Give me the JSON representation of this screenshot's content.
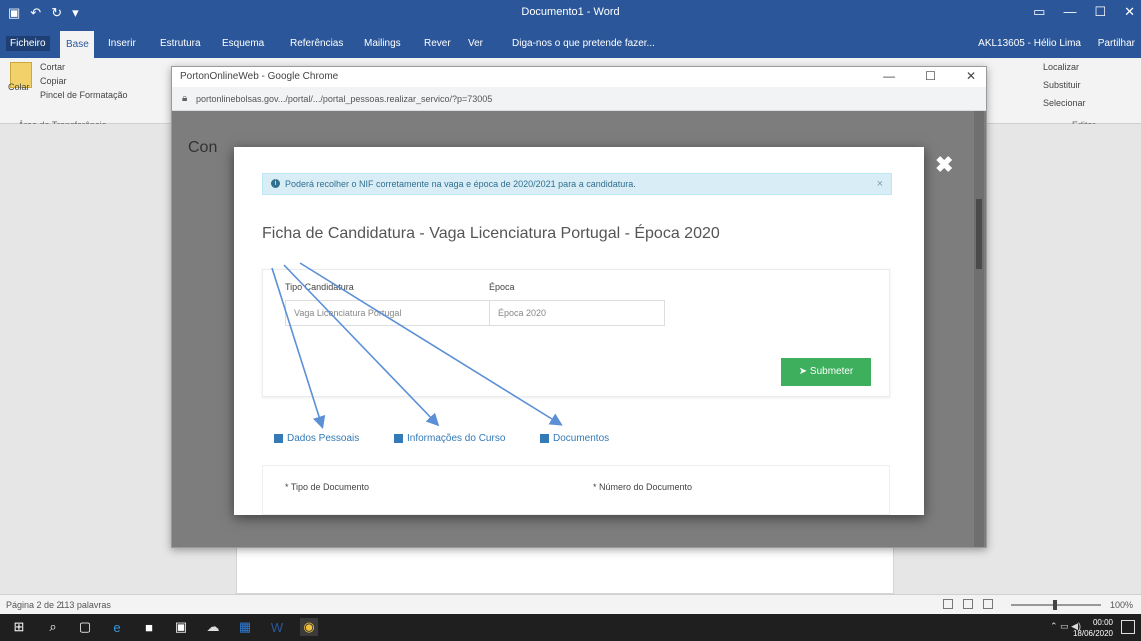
{
  "word": {
    "title": "Documento1 - Word",
    "tabs": [
      "Ficheiro",
      "Base",
      "Inserir",
      "Estrutura",
      "Esquema",
      "Referências",
      "Mailings",
      "Rever",
      "Ver"
    ],
    "search": "Diga-nos o que pretende fazer...",
    "account": "AKL13605 - Hélio Lima",
    "share": "Partilhar",
    "ribbon": {
      "paste": "Colar",
      "cut": "Cortar",
      "copy": "Copiar",
      "format_painter": "Pincel de Formatação",
      "clipboard_group": "Área de Transferência",
      "find": "Localizar",
      "replace": "Substituir",
      "select": "Selecionar",
      "editing_group": "Editar"
    },
    "status": {
      "page": "Página 2 de 2",
      "words": "113 palavras",
      "zoom": "100%"
    }
  },
  "chrome": {
    "title": "PortonOnlineWeb - Google Chrome",
    "url": "portonlinebolsas.gov.../portal/.../portal_pessoas.realizar_servico/?p=73005",
    "bg_heading": "Con",
    "controls": [
      "—",
      "☐",
      "✕"
    ]
  },
  "modal": {
    "close": "✖",
    "alert": "Poderá recolher o NIF corretamente na vaga e época de 2020/2021 para a candidatura.",
    "title": "Ficha de Candidatura - Vaga Licenciatura Portugal - Época 2020",
    "fields": {
      "tipo_label": "Tipo Candidatura",
      "tipo_value": "Vaga Licenciatura Portugal",
      "epoca_label": "Época",
      "epoca_value": "Época 2020"
    },
    "submit": "Submeter",
    "tabs": [
      "Dados Pessoais",
      "Informações do Curso",
      "Documentos"
    ],
    "form": {
      "doc_type": "* Tipo de Documento",
      "doc_number": "* Número do Documento"
    }
  },
  "taskbar": {
    "time": "00:00",
    "date": "18/06/2020"
  }
}
